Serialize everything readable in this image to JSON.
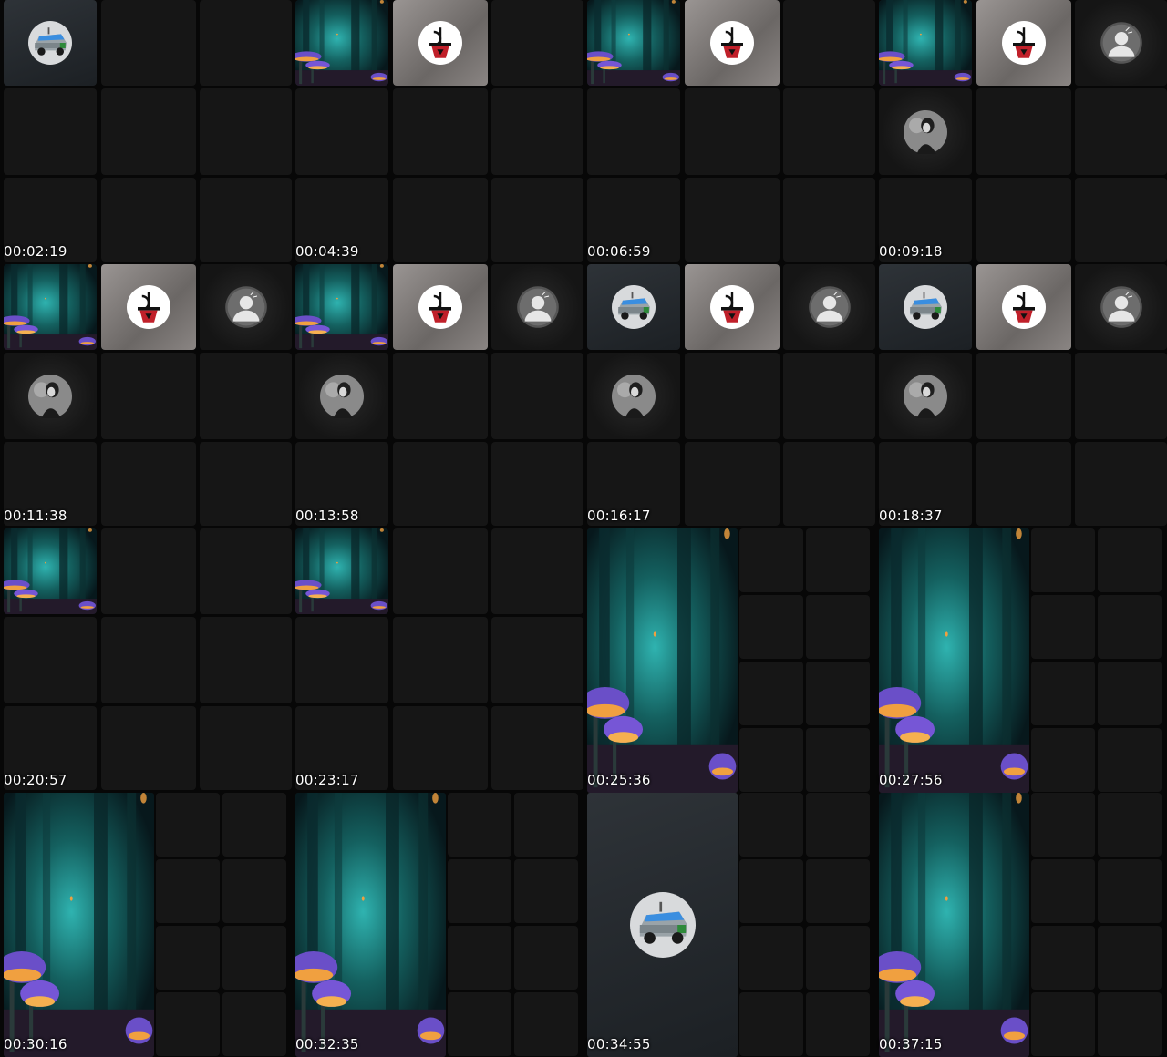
{
  "contact_sheet": {
    "frames": [
      {
        "timestamp": "00:02:19",
        "layout": "grid3x3",
        "tiles": [
          "tesla-avatar",
          "empty",
          "empty",
          "empty",
          "empty",
          "empty",
          "empty",
          "empty",
          "empty"
        ]
      },
      {
        "timestamp": "00:04:39",
        "layout": "grid3x3",
        "tiles": [
          "forest",
          "logo-avatar",
          "empty",
          "empty",
          "empty",
          "empty",
          "empty",
          "empty",
          "empty"
        ]
      },
      {
        "timestamp": "00:06:59",
        "layout": "grid3x3",
        "tiles": [
          "forest",
          "logo-avatar",
          "empty",
          "empty",
          "empty",
          "empty",
          "empty",
          "empty",
          "empty"
        ]
      },
      {
        "timestamp": "00:09:18",
        "layout": "grid3x3",
        "tiles": [
          "forest",
          "logo-avatar",
          "user-avatar",
          "woman-avatar",
          "empty",
          "empty",
          "empty",
          "empty",
          "empty"
        ]
      },
      {
        "timestamp": "00:11:38",
        "layout": "grid3x3",
        "tiles": [
          "forest",
          "logo-avatar",
          "user-avatar",
          "woman-avatar",
          "empty",
          "empty",
          "empty",
          "empty",
          "empty"
        ]
      },
      {
        "timestamp": "00:13:58",
        "layout": "grid3x3",
        "tiles": [
          "forest",
          "logo-avatar",
          "user-avatar",
          "woman-avatar",
          "empty",
          "empty",
          "empty",
          "empty",
          "empty"
        ]
      },
      {
        "timestamp": "00:16:17",
        "layout": "grid3x3",
        "tiles": [
          "tesla-avatar",
          "logo-avatar",
          "user-avatar",
          "woman-avatar",
          "empty",
          "empty",
          "empty",
          "empty",
          "empty"
        ]
      },
      {
        "timestamp": "00:18:37",
        "layout": "grid3x3",
        "tiles": [
          "tesla-avatar",
          "logo-avatar",
          "user-avatar",
          "woman-avatar",
          "empty",
          "empty",
          "empty",
          "empty",
          "empty"
        ]
      },
      {
        "timestamp": "00:20:57",
        "layout": "grid3x3",
        "tiles": [
          "forest",
          "empty",
          "empty",
          "empty",
          "empty",
          "empty",
          "empty",
          "empty",
          "empty"
        ]
      },
      {
        "timestamp": "00:23:17",
        "layout": "grid3x3",
        "tiles": [
          "forest",
          "empty",
          "empty",
          "empty",
          "empty",
          "empty",
          "empty",
          "empty",
          "empty"
        ]
      },
      {
        "timestamp": "00:25:36",
        "layout": "spotlight",
        "tiles": [
          "forest-large"
        ]
      },
      {
        "timestamp": "00:27:56",
        "layout": "spotlight",
        "tiles": [
          "forest-large"
        ]
      },
      {
        "timestamp": "00:30:16",
        "layout": "spotlight",
        "tiles": [
          "forest-large"
        ]
      },
      {
        "timestamp": "00:32:35",
        "layout": "spotlight",
        "tiles": [
          "forest-large"
        ]
      },
      {
        "timestamp": "00:34:55",
        "layout": "spotlight",
        "tiles": [
          "tesla-large"
        ]
      },
      {
        "timestamp": "00:37:15",
        "layout": "spotlight",
        "tiles": [
          "forest-large"
        ]
      }
    ]
  },
  "colors": {
    "background": "#000000",
    "tile": "#161616",
    "logo_tile": "#8a8583",
    "forest_teal": "#2fb3b0",
    "mushroom_purple": "#6a4fc8",
    "mushroom_glow": "#f0a040",
    "tesla_blue": "#3a8ee0"
  },
  "icons": [
    "tesla-cybertruck-icon",
    "red-logo-icon",
    "user-icon",
    "woman-portrait-icon",
    "forest-mushroom-image"
  ]
}
